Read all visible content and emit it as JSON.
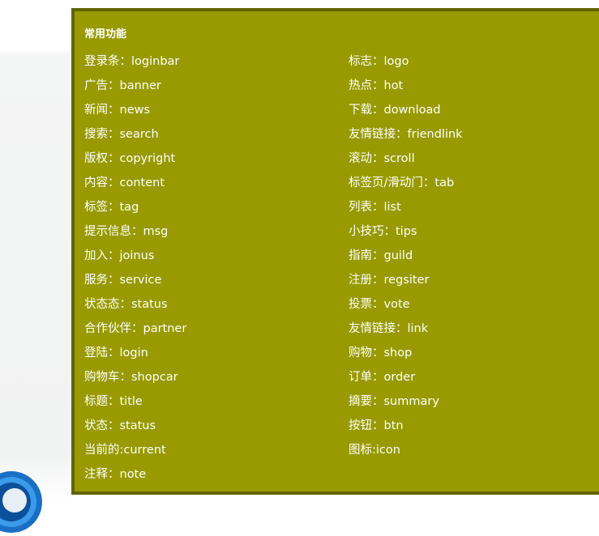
{
  "panel": {
    "title": "常用功能",
    "left_items": [
      "登录条：loginbar",
      "广告：banner",
      "新闻：news",
      "搜索：search",
      "版权：copyright",
      "内容：content",
      "标签：tag",
      "提示信息：msg",
      "加入：joinus",
      "服务：service",
      "状态态：status",
      "合作伙伴：partner",
      "登陆：login",
      "购物车：shopcar",
      "标题：title",
      "状态：status",
      "当前的:current",
      "注释：note"
    ],
    "right_items": [
      "标志：logo",
      "热点：hot",
      "下载：download",
      "友情链接：friendlink",
      "滚动：scroll",
      "标签页/滑动门：tab",
      "列表：list",
      "小技巧：tips",
      "指南：guild",
      "注册：regsiter",
      "投票：vote",
      "友情链接：link",
      "购物：shop",
      "订单：order",
      "摘要：summary",
      "按钮：btn",
      "图标:icon"
    ]
  },
  "colors": {
    "panel_background": "#989a00",
    "panel_border": "#626400",
    "text": "#ffffff"
  }
}
